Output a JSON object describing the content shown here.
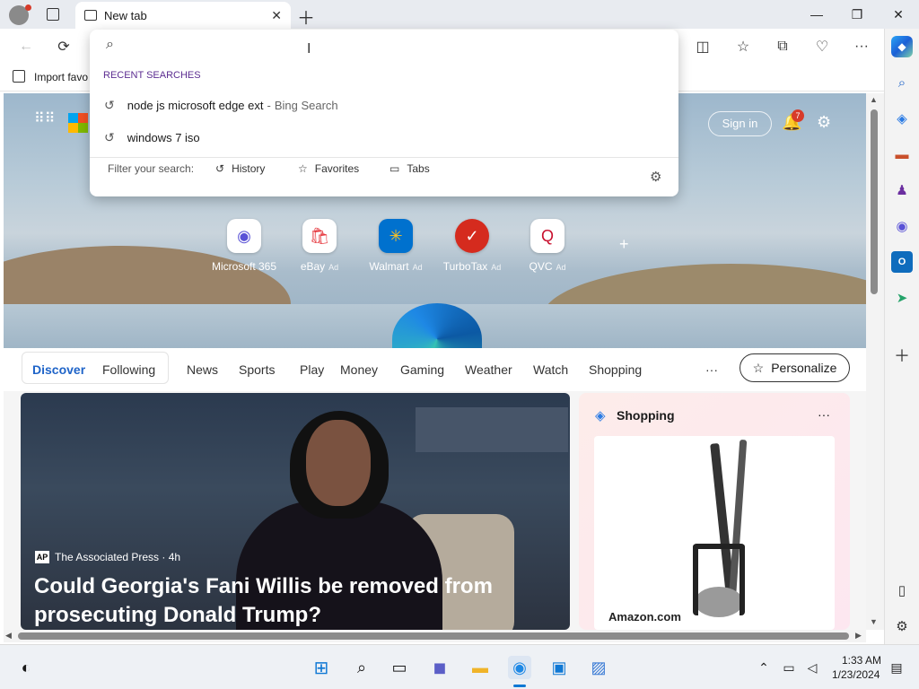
{
  "browser": {
    "tab_title": "New tab",
    "favorites_bar_item": "Import favo"
  },
  "address_dropdown": {
    "section_label": "RECENT SEARCHES",
    "searches": [
      {
        "query": "node js microsoft edge ext",
        "suffix": "Bing Search"
      },
      {
        "query": "windows 7 iso",
        "suffix": ""
      }
    ],
    "filter_label": "Filter your search:",
    "filters": [
      "History",
      "Favorites",
      "Tabs"
    ]
  },
  "newtab": {
    "sign_in": "Sign in",
    "notification_count": "7",
    "quick_links": [
      {
        "label": "Microsoft 365",
        "ad": ""
      },
      {
        "label": "eBay",
        "ad": "Ad"
      },
      {
        "label": "Walmart",
        "ad": "Ad"
      },
      {
        "label": "TurboTax",
        "ad": "Ad"
      },
      {
        "label": "QVC",
        "ad": "Ad"
      }
    ],
    "add_link": "+"
  },
  "feed_nav": {
    "tabs": [
      "Discover",
      "Following"
    ],
    "active_tab": "Discover",
    "items": [
      "News",
      "Sports",
      "Play",
      "Money",
      "Gaming",
      "Weather",
      "Watch",
      "Shopping"
    ],
    "more": "···",
    "personalize": "Personalize"
  },
  "hero_story": {
    "source_logo": "AP",
    "source": "The Associated Press · 4h",
    "title": "Could Georgia's Fani Willis be removed from prosecuting Donald Trump?"
  },
  "shopping_card": {
    "title": "Shopping",
    "more": "···",
    "store": "Amazon.com"
  },
  "taskbar": {
    "time": "1:33 AM",
    "date": "1/23/2024"
  },
  "colors": {
    "accent": "#1f64c8",
    "active_tab_text": "#1f64c8",
    "notification_badge": "#d73b2a",
    "recent_label": "#5c2d91"
  }
}
